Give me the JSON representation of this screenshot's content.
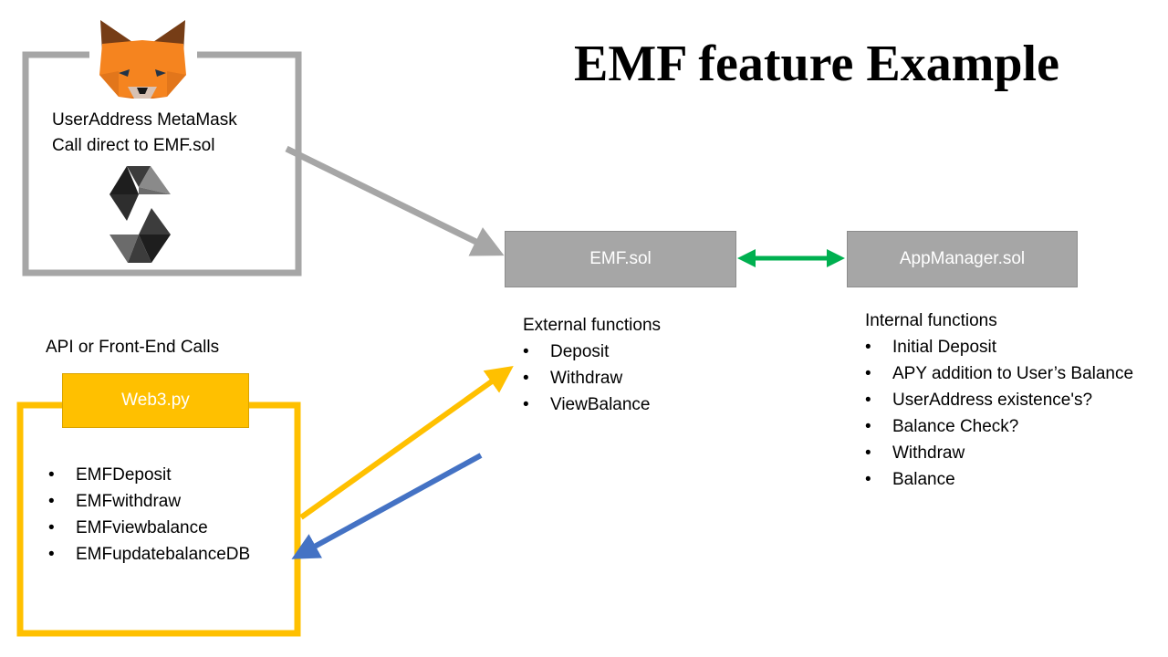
{
  "title": "EMF feature Example",
  "metamask": {
    "line1": "UserAddress MetaMask",
    "line2": "Call direct to EMF.sol",
    "icons": [
      "metamask-fox-icon",
      "solidity-logo-icon"
    ]
  },
  "emf": {
    "label": "EMF.sol",
    "heading": "External functions",
    "items": [
      "Deposit",
      "Withdraw",
      "ViewBalance"
    ]
  },
  "appmanager": {
    "label": "AppManager.sol",
    "heading": "Internal functions",
    "items": [
      "Initial Deposit",
      "APY addition to User’s Balance",
      "UserAddress existence's?",
      "Balance Check?",
      "Withdraw",
      "Balance"
    ]
  },
  "web3": {
    "caption": "API or Front-End Calls",
    "label": "Web3.py",
    "items": [
      "EMFDeposit",
      "EMFwithdraw",
      "EMFviewbalance",
      "EMFupdatebalanceDB"
    ]
  },
  "colors": {
    "gray": "#a6a6a6",
    "yellow": "#ffc000",
    "blue": "#4472c4",
    "green": "#00b050"
  }
}
